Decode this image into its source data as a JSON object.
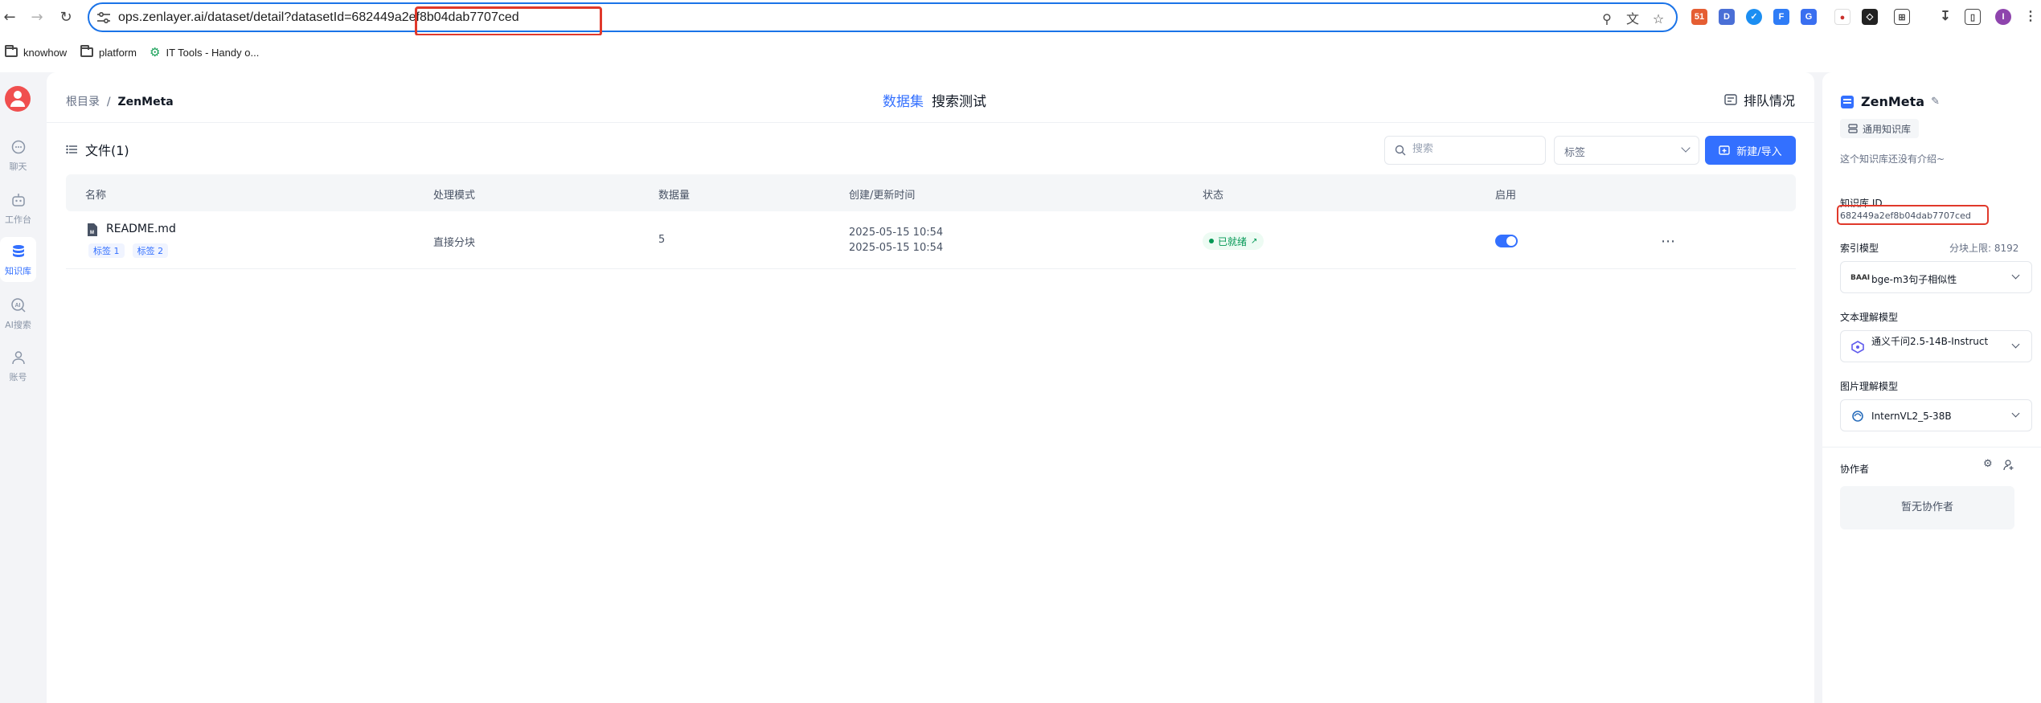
{
  "browser": {
    "url": "ops.zenlayer.ai/dataset/detail?datasetId=682449a2ef8b04dab7707ced",
    "bookmarks": [
      {
        "label": "knowhow"
      },
      {
        "label": "platform"
      },
      {
        "label": "IT Tools - Handy o..."
      }
    ],
    "extension_badge": "51",
    "profile_initial": "I"
  },
  "left_nav": {
    "items": [
      {
        "label": "聊天",
        "icon": "chat-icon"
      },
      {
        "label": "工作台",
        "icon": "robot-icon"
      },
      {
        "label": "知识库",
        "icon": "database-icon"
      },
      {
        "label": "AI搜索",
        "icon": "ai-search-icon"
      },
      {
        "label": "账号",
        "icon": "user-icon"
      }
    ],
    "active_index": 2
  },
  "main": {
    "breadcrumb": {
      "root": "根目录",
      "separator": "/",
      "current": "ZenMeta"
    },
    "tabs": [
      {
        "label": "数据集"
      },
      {
        "label": "搜索测试"
      }
    ],
    "queue_label": "排队情况",
    "files_title": "文件(1)",
    "search_placeholder": "搜索",
    "tag_select_value": "标签",
    "new_button_label": "新建/导入",
    "table": {
      "columns": [
        "名称",
        "处理模式",
        "数据量",
        "创建/更新时间",
        "状态",
        "启用"
      ],
      "rows": [
        {
          "name": "README.md",
          "tags": [
            "标签 1",
            "标签 2"
          ],
          "mode": "直接分块",
          "count": "5",
          "created": "2025-05-15 10:54",
          "updated": "2025-05-15 10:54",
          "status": "已就绪",
          "enabled": true
        }
      ]
    }
  },
  "right_panel": {
    "title": "ZenMeta",
    "type_label": "通用知识库",
    "intro": "这个知识库还没有介绍~",
    "id_label": "知识库 ID",
    "id_value": "682449a2ef8b04dab7707ced",
    "index_model_label": "索引模型",
    "chunk_limit": "分块上限: 8192",
    "index_model_value": "bge-m3句子相似性",
    "index_model_logo": "BAAI",
    "text_model_label": "文本理解模型",
    "text_model_value": "通义千问2.5-14B-Instruct",
    "image_model_label": "图片理解模型",
    "image_model_value": "InternVL2_5-38B",
    "collaborators_label": "协作者",
    "no_collaborators": "暂无协作者"
  },
  "colors": {
    "accent": "#3370ff",
    "highlight_box": "#e0392b",
    "status_green": "#039855",
    "avatar_red": "#f04f4f"
  }
}
